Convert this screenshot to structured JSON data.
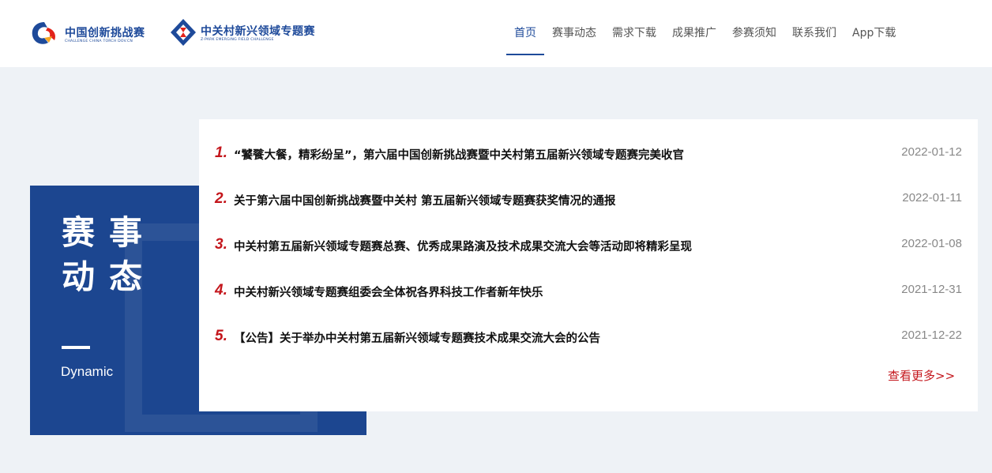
{
  "header": {
    "logo1": {
      "title": "中国创新挑战赛",
      "subtitle": "CHALLENGE CHINA TORCH DOV.CN",
      "icon": "china-innovation-challenge-logo-icon"
    },
    "logo2": {
      "title": "中关村新兴领域专题赛",
      "subtitle": "Z-PARK EMERGING FIELD CHALLENGE",
      "icon": "zpark-emerging-field-logo-icon"
    },
    "nav": [
      {
        "label": "首页",
        "active": true
      },
      {
        "label": "赛事动态"
      },
      {
        "label": "需求下载"
      },
      {
        "label": "成果推广"
      },
      {
        "label": "参赛须知"
      },
      {
        "label": "联系我们"
      },
      {
        "label": "App下载"
      }
    ]
  },
  "panel": {
    "title": "赛事动态",
    "subtitle": "Dynamic"
  },
  "news": [
    {
      "num": "1.",
      "title": "“饕餮大餐，精彩纷呈”，第六届中国创新挑战赛暨中关村第五届新兴领域专题赛完美收官",
      "date": "2022-01-12"
    },
    {
      "num": "2.",
      "title": "关于第六届中国创新挑战赛暨中关村 第五届新兴领域专题赛获奖情况的通报",
      "date": "2022-01-11"
    },
    {
      "num": "3.",
      "title": "中关村第五届新兴领域专题赛总赛、优秀成果路演及技术成果交流大会等活动即将精彩呈现",
      "date": "2022-01-08"
    },
    {
      "num": "4.",
      "title": "中关村新兴领域专题赛组委会全体祝各界科技工作者新年快乐",
      "date": "2021-12-31"
    },
    {
      "num": "5.",
      "title": "【公告】关于举办中关村第五届新兴领域专题赛技术成果交流大会的公告",
      "date": "2021-12-22"
    }
  ],
  "more_label": "查看更多>>",
  "colors": {
    "brand_blue": "#1c4690",
    "accent_red": "#c4161c",
    "nav_active": "#1e4a9a"
  }
}
